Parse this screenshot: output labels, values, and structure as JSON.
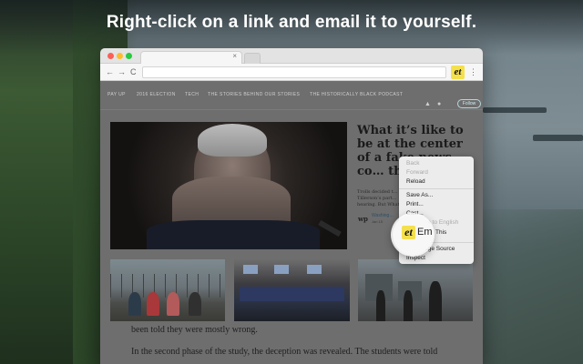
{
  "headline": "Right-click on a link and email it to yourself.",
  "browser": {
    "tab_close": "×",
    "nav": {
      "back": "←",
      "forward": "→",
      "reload": "C"
    },
    "extension_icon": "et",
    "menu": "⋮"
  },
  "site": {
    "nav_items": [
      "PAY UP",
      "2016 ELECTION",
      "TECH",
      "THE STORIES BEHIND OUR STORIES",
      "THE HISTORICALLY BLACK PODCAST"
    ],
    "follow_label": "Follow",
    "social_icons": [
      "twitter-icon",
      "facebook-icon"
    ]
  },
  "article": {
    "title": "What it’s like to be at the center of a fake news co… theory",
    "blurb": "Trolls decided t… Tillerson’s part… hearing. But What…",
    "byline_logo": "wp",
    "byline_name": "Washing…",
    "byline_date": "Jan 15"
  },
  "body_lines": [
    "been told they were mostly wrong.",
    "In the second phase of the study, the deception was revealed. The students were told"
  ],
  "context_menu": {
    "items": [
      {
        "label": "Back",
        "enabled": false
      },
      {
        "label": "Forward",
        "enabled": false
      },
      {
        "label": "Reload",
        "enabled": true
      },
      {
        "label": "Save As...",
        "enabled": true
      },
      {
        "label": "Print...",
        "enabled": true
      },
      {
        "label": "Cast...",
        "enabled": true
      },
      {
        "label": "Translate to English",
        "enabled": false
      },
      {
        "label": "Email This",
        "enabled": true
      },
      {
        "label": "View Page Source",
        "enabled": true
      },
      {
        "label": "Inspect",
        "enabled": true
      }
    ],
    "magnified_icon": "et",
    "magnified_label": "Email This",
    "magnified_tail": "This"
  },
  "colors": {
    "extension_yellow": "#f4e04d",
    "mac_red": "#fc5f57",
    "mac_yellow": "#fdbc2e",
    "mac_green": "#29c940"
  }
}
